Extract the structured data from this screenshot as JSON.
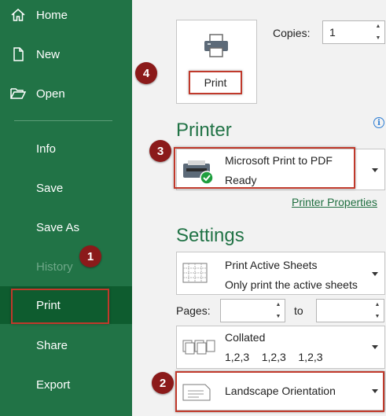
{
  "sidebar": {
    "items": [
      {
        "label": "Home",
        "icon": "home-icon"
      },
      {
        "label": "New",
        "icon": "new-document-icon"
      },
      {
        "label": "Open",
        "icon": "open-folder-icon"
      },
      {
        "label": "Info"
      },
      {
        "label": "Save"
      },
      {
        "label": "Save As"
      },
      {
        "label": "History"
      },
      {
        "label": "Print"
      },
      {
        "label": "Share"
      },
      {
        "label": "Export"
      }
    ]
  },
  "print_button": {
    "label": "Print"
  },
  "copies": {
    "label": "Copies:",
    "value": "1"
  },
  "printer": {
    "section_title": "Printer",
    "name": "Microsoft Print to PDF",
    "status": "Ready",
    "properties_link": "Printer Properties"
  },
  "settings": {
    "section_title": "Settings",
    "print_what": {
      "title": "Print Active Sheets",
      "description": "Only print the active sheets"
    },
    "pages": {
      "label": "Pages:",
      "to_label": "to",
      "from_value": "",
      "to_value": ""
    },
    "collation": {
      "title": "Collated",
      "description": "1,2,3    1,2,3    1,2,3"
    },
    "orientation": {
      "title": "Landscape Orientation"
    }
  },
  "callouts": [
    "1",
    "2",
    "3",
    "4"
  ],
  "colors": {
    "sidebar": "#217346",
    "sidebar_active": "#0e5c2f",
    "accent_green": "#217346",
    "callout": "#8b1a1a",
    "highlight": "#c0392b"
  }
}
